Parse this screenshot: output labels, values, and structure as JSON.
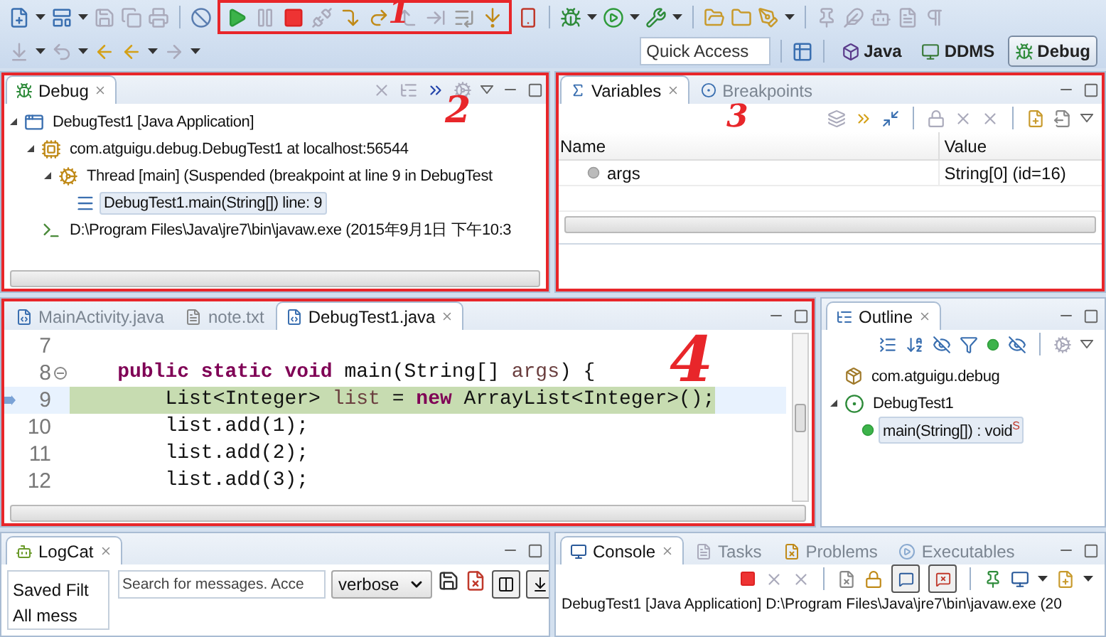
{
  "toolbar": {
    "annotation": "1",
    "quick_access": {
      "placeholder": "Quick Access"
    },
    "perspectives": [
      {
        "label": "Java",
        "selected": false
      },
      {
        "label": "DDMS",
        "selected": false
      },
      {
        "label": "Debug",
        "selected": true
      }
    ]
  },
  "debug_view": {
    "title": "Debug",
    "annotation": "2",
    "tree": [
      {
        "label": "DebugTest1 [Java Application]",
        "kind": "launch",
        "expanded": true,
        "selected": false,
        "children": [
          {
            "label": "com.atguigu.debug.DebugTest1 at localhost:56544",
            "kind": "target",
            "expanded": true,
            "selected": false,
            "children": [
              {
                "label": "Thread [main] (Suspended (breakpoint at line 9 in DebugTest",
                "kind": "thread",
                "expanded": true,
                "selected": false,
                "children": [
                  {
                    "label": "DebugTest1.main(String[]) line: 9",
                    "kind": "frame",
                    "selected": true
                  }
                ]
              }
            ]
          },
          {
            "label": "D:\\Program Files\\Java\\jre7\\bin\\javaw.exe (2015年9月1日 下午10:3",
            "kind": "process",
            "selected": false
          }
        ]
      }
    ]
  },
  "variables_view": {
    "annotation": "3",
    "tabs": [
      {
        "label": "Variables",
        "selected": true
      },
      {
        "label": "Breakpoints",
        "selected": false
      }
    ],
    "columns": [
      "Name",
      "Value"
    ],
    "rows": [
      {
        "name": "args",
        "value": "String[0]  (id=16)"
      }
    ]
  },
  "editor": {
    "annotation": "4",
    "tabs": [
      {
        "label": "MainActivity.java",
        "kind": "java",
        "selected": false
      },
      {
        "label": "note.txt",
        "kind": "text",
        "selected": false
      },
      {
        "label": "DebugTest1.java",
        "kind": "java",
        "selected": true
      }
    ],
    "lines": [
      {
        "number": "7",
        "current": false,
        "foldable": false
      },
      {
        "number": "8",
        "current": false,
        "foldable": true,
        "tokens": [
          {
            "text": "    public static void",
            "kind": "keyword"
          },
          {
            "text": " main(String[] ",
            "kind": "plain"
          },
          {
            "text": "args",
            "kind": "variable"
          },
          {
            "text": ") {",
            "kind": "plain"
          }
        ]
      },
      {
        "number": "9",
        "current": true,
        "foldable": false,
        "tokens": [
          {
            "text": "        List<Integer> ",
            "kind": "plain"
          },
          {
            "text": "list",
            "kind": "variable"
          },
          {
            "text": " = ",
            "kind": "plain"
          },
          {
            "text": "new",
            "kind": "keyword"
          },
          {
            "text": " ArrayList<Integer>();",
            "kind": "plain"
          }
        ]
      },
      {
        "number": "10",
        "current": false,
        "foldable": false,
        "tokens": [
          {
            "text": "        list.add(1);",
            "kind": "plain"
          }
        ]
      },
      {
        "number": "11",
        "current": false,
        "foldable": false,
        "tokens": [
          {
            "text": "        list.add(2);",
            "kind": "plain"
          }
        ]
      },
      {
        "number": "12",
        "current": false,
        "foldable": false,
        "tokens": [
          {
            "text": "        list.add(3);",
            "kind": "plain"
          }
        ]
      }
    ]
  },
  "outline_view": {
    "title": "Outline",
    "tree": [
      {
        "label": "com.atguigu.debug",
        "kind": "package",
        "selected": false
      },
      {
        "label": "DebugTest1",
        "kind": "class",
        "expanded": true,
        "selected": false,
        "children": [
          {
            "label": "main(String[]) : void",
            "kind": "method",
            "modifier": "S",
            "selected": true
          }
        ]
      }
    ]
  },
  "logcat_view": {
    "title": "LogCat",
    "saved_filters": {
      "heading": "Saved Filt",
      "items": [
        "All mess"
      ]
    },
    "search": {
      "placeholder": "Search for messages. Acce"
    },
    "level_select": "verbose"
  },
  "console_view": {
    "tabs": [
      {
        "label": "Console",
        "selected": true
      },
      {
        "label": "Tasks",
        "selected": false
      },
      {
        "label": "Problems",
        "selected": false
      },
      {
        "label": "Executables",
        "selected": false
      }
    ],
    "output": "DebugTest1 [Java Application] D:\\Program Files\\Java\\jre7\\bin\\javaw.exe (20"
  }
}
